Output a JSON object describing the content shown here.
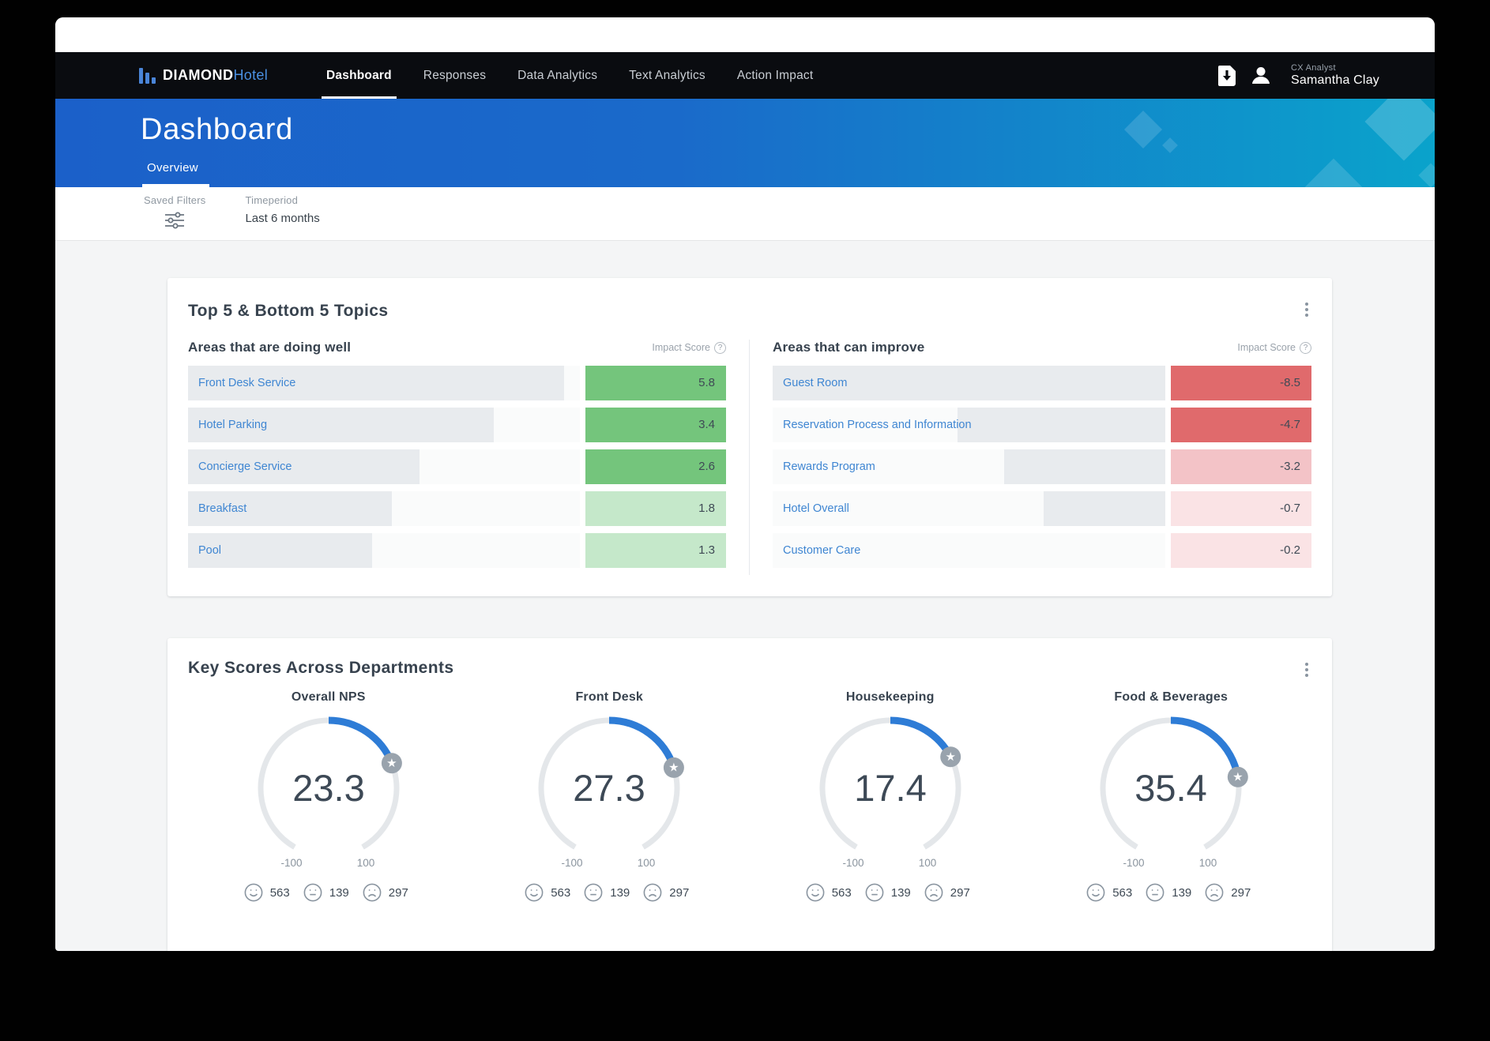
{
  "nav": {
    "brand": {
      "bold": "DIAMOND",
      "light": "Hotel"
    },
    "items": [
      {
        "label": "Dashboard",
        "active": true
      },
      {
        "label": "Responses",
        "active": false
      },
      {
        "label": "Data Analytics",
        "active": false
      },
      {
        "label": "Text Analytics",
        "active": false
      },
      {
        "label": "Action Impact",
        "active": false
      }
    ],
    "user": {
      "role": "CX Analyst",
      "name": "Samantha Clay"
    }
  },
  "header": {
    "title": "Dashboard",
    "tab": "Overview"
  },
  "filters": {
    "saved_filters_label": "Saved Filters",
    "timeperiod_label": "Timeperiod",
    "timeperiod_value": "Last 6 months"
  },
  "topics_card": {
    "title": "Top 5 & Bottom 5 Topics",
    "impact_score_label": "Impact Score",
    "well": {
      "heading": "Areas that are doing well",
      "rows": [
        {
          "label": "Front Desk Service",
          "score": "5.8",
          "bar_width": "96%",
          "color": "#74c57c"
        },
        {
          "label": "Hotel Parking",
          "score": "3.4",
          "bar_width": "78%",
          "color": "#74c57c"
        },
        {
          "label": "Concierge Service",
          "score": "2.6",
          "bar_width": "59%",
          "color": "#74c57c"
        },
        {
          "label": "Breakfast",
          "score": "1.8",
          "bar_width": "52%",
          "color": "#c5e8ca"
        },
        {
          "label": "Pool",
          "score": "1.3",
          "bar_width": "47%",
          "color": "#c5e8ca"
        }
      ]
    },
    "improve": {
      "heading": "Areas that can improve",
      "rows": [
        {
          "label": "Guest Room",
          "score": "-8.5",
          "bar_width": "100%",
          "color": "#e06a6c"
        },
        {
          "label": "Reservation Process and Information",
          "score": "-4.7",
          "bar_width": "53%",
          "color": "#e06a6c"
        },
        {
          "label": "Rewards Program",
          "score": "-3.2",
          "bar_width": "41%",
          "color": "#f3c3c7"
        },
        {
          "label": "Hotel Overall",
          "score": "-0.7",
          "bar_width": "31%",
          "color": "#fae3e5"
        },
        {
          "label": "Customer Care",
          "score": "-0.2",
          "bar_width": "0%",
          "color": "#fae3e5"
        }
      ]
    }
  },
  "key_scores_card": {
    "title": "Key Scores Across Departments",
    "arc_color": "#2e7cd6",
    "ring_color": "#e4e7ea",
    "gauges": [
      {
        "title": "Overall NPS",
        "value": "23.3",
        "min": "-100",
        "max": "100",
        "happy": "563",
        "neutral": "139",
        "sad": "297"
      },
      {
        "title": "Front Desk",
        "value": "27.3",
        "min": "-100",
        "max": "100",
        "happy": "563",
        "neutral": "139",
        "sad": "297"
      },
      {
        "title": "Housekeeping",
        "value": "17.4",
        "min": "-100",
        "max": "100",
        "happy": "563",
        "neutral": "139",
        "sad": "297"
      },
      {
        "title": "Food & Beverages",
        "value": "35.4",
        "min": "-100",
        "max": "100",
        "happy": "563",
        "neutral": "139",
        "sad": "297"
      }
    ]
  }
}
